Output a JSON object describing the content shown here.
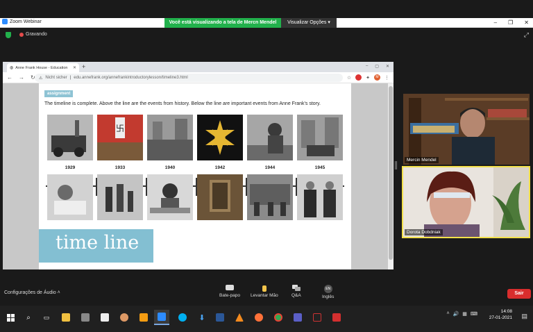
{
  "window": {
    "app_title": "Zoom Webinar",
    "share_banner": "Você está visualizando a tela de Mercn Mendel",
    "view_options": "Visualizar Opções"
  },
  "zoom_top": {
    "recording_label": "Gravando"
  },
  "browser": {
    "tab_title": "Anne Frank House - Education",
    "not_secure": "Nicht sicher",
    "url": "edu.annefrank.org/annefrankintroductorylesson/timeline3.html",
    "profile_initial": "M"
  },
  "lesson": {
    "badge": "assignment",
    "intro": "The timeline is complete. Above the line are the events from history. Below the line are important events from Anne Frank's story.",
    "years": [
      "1929",
      "1933",
      "1940",
      "1942",
      "1944",
      "1945"
    ],
    "footer_title": "time line"
  },
  "participants": [
    {
      "name": "Mercin Mendel"
    },
    {
      "name": "Dorota Dobdniak"
    }
  ],
  "controls": {
    "audio_settings": "Configurações de Áudio",
    "chat": "Bate-papo",
    "raise_hand": "Levantar Mão",
    "qa": "Q&A",
    "language_code": "EN",
    "language": "Inglês",
    "leave": "Sair"
  },
  "taskbar": {
    "time": "14:08",
    "date": "27-01-2021"
  },
  "colors": {
    "banner_green": "#22b14c",
    "leave_red": "#d92d2d",
    "timeline_blue": "#83bfd2"
  }
}
